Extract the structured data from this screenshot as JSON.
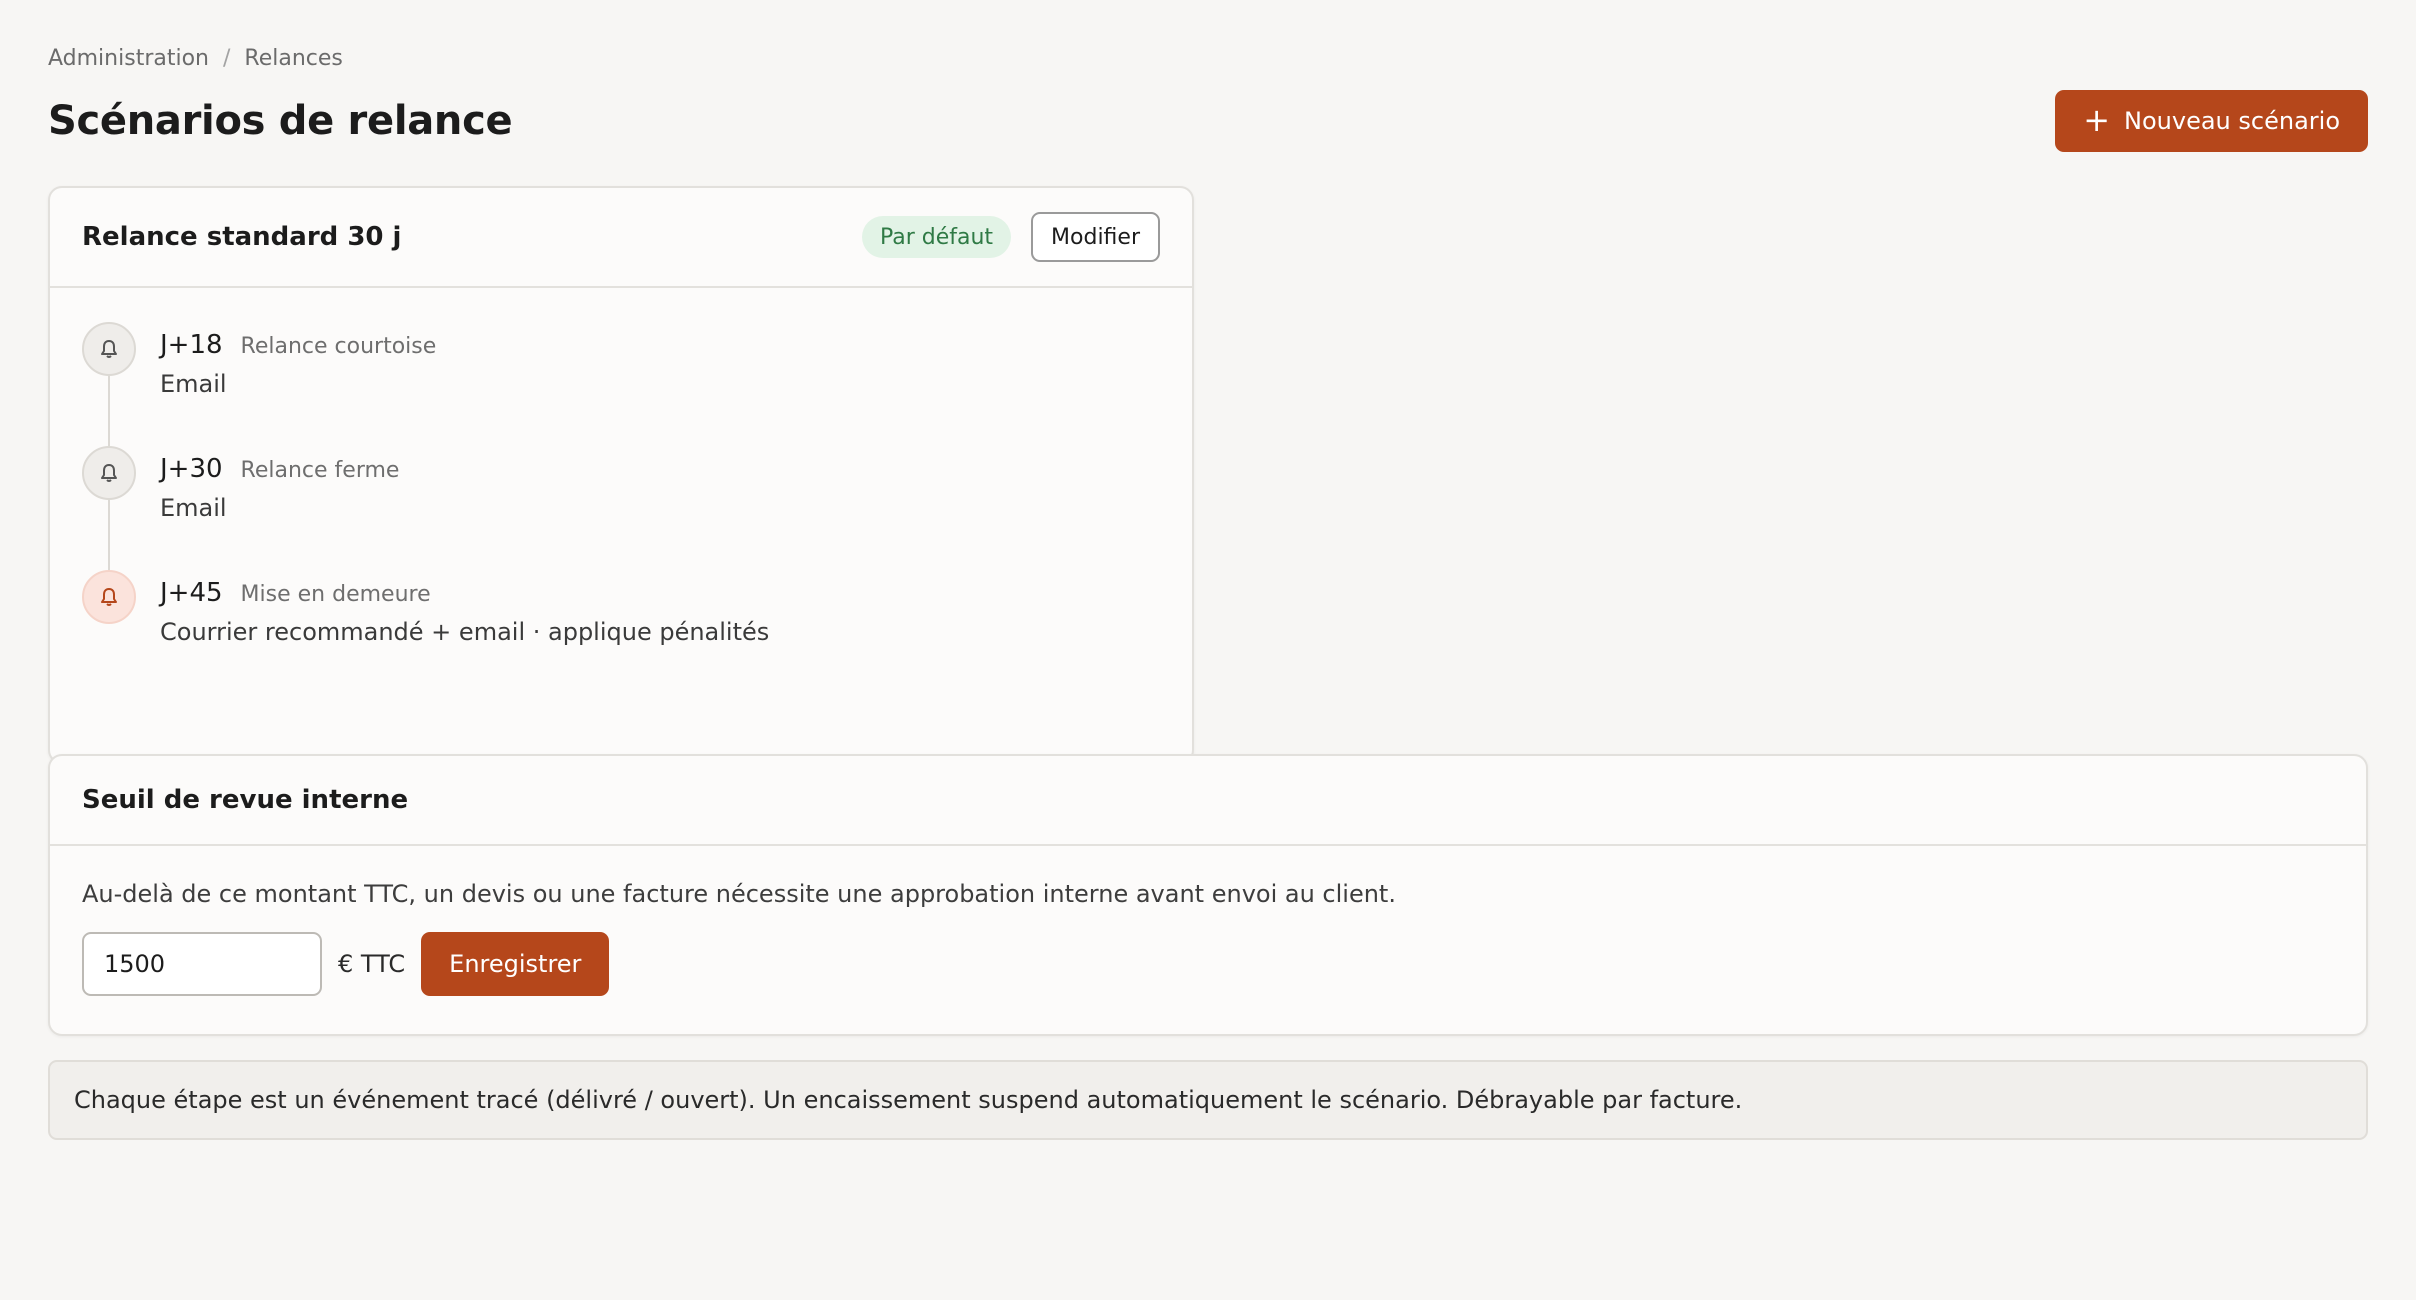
{
  "breadcrumb": {
    "items": [
      "Administration",
      "Relances"
    ],
    "separator": "/"
  },
  "header": {
    "title": "Scénarios de relance",
    "new_button_icon": "plus-icon",
    "new_button_label": "Nouveau scénario"
  },
  "scenario": {
    "title": "Relance standard 30 j",
    "badge": "Par défaut",
    "edit_label": "Modifier",
    "steps": [
      {
        "day": "J+18",
        "name": "Relance courtoise",
        "description": "Email",
        "icon": "bell-icon",
        "severity": "normal"
      },
      {
        "day": "J+30",
        "name": "Relance ferme",
        "description": "Email",
        "icon": "bell-icon",
        "severity": "normal"
      },
      {
        "day": "J+45",
        "name": "Mise en demeure",
        "description": "Courrier recommandé + email · applique pénalités",
        "icon": "bell-icon",
        "severity": "danger"
      }
    ]
  },
  "threshold": {
    "title": "Seuil de revue interne",
    "description": "Au-delà de ce montant TTC, un devis ou une facture nécessite une approbation interne avant envoi au client.",
    "value": "1500",
    "unit": "€ TTC",
    "save_label": "Enregistrer"
  },
  "note": "Chaque étape est un événement tracé (délivré / ouvert). Un encaissement suspend automatiquement le scénario. Débrayable par facture.",
  "colors": {
    "accent": "#b5471b",
    "badge_bg": "#e2f3e6",
    "badge_text": "#2f7a45",
    "danger_circle": "#fbe3dc",
    "danger_icon": "#b5471b"
  }
}
